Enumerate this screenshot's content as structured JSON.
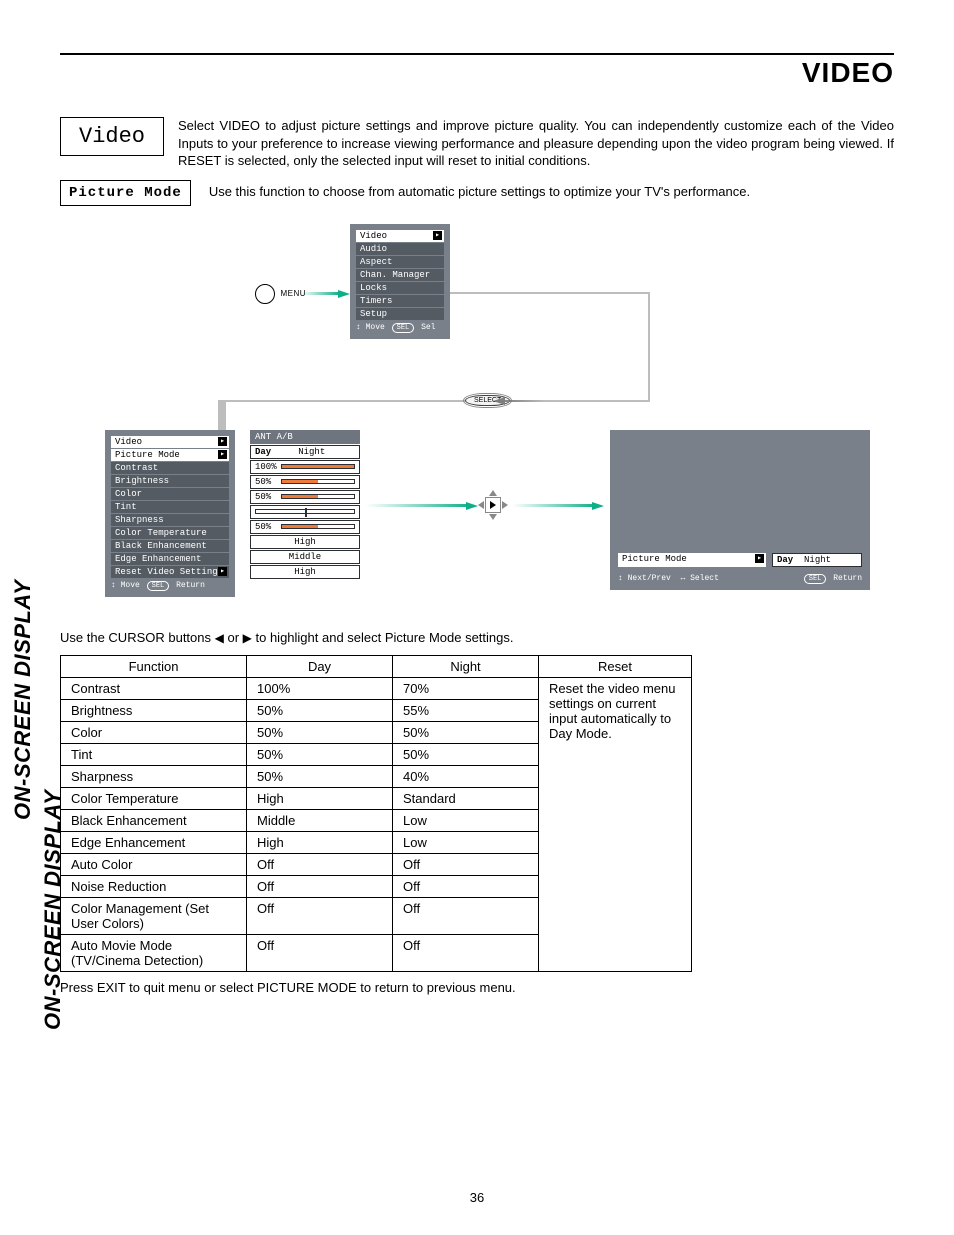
{
  "header": {
    "title": "VIDEO"
  },
  "intro": {
    "box_label": "Video",
    "text": "Select VIDEO to adjust picture settings and improve picture quality.  You can independently customize each of the Video Inputs to your preference to increase viewing performance and pleasure depending upon the video program being viewed.  If RESET is selected, only the selected input will reset to initial conditions."
  },
  "picture_mode": {
    "label": "Picture Mode",
    "text": "Use this function to choose from automatic picture settings to optimize your TV's performance."
  },
  "menu_button": {
    "label": "MENU"
  },
  "select_button": {
    "label": "SELECT"
  },
  "main_osd": {
    "items": [
      "Video",
      "Audio",
      "Aspect",
      "Chan. Manager",
      "Locks",
      "Timers",
      "Setup"
    ],
    "footer_move": "Move",
    "footer_sel": "Sel",
    "sel_pill": "SEL"
  },
  "video_osd": {
    "title": "Video",
    "items": [
      "Picture Mode",
      "Contrast",
      "Brightness",
      "Color",
      "Tint",
      "Sharpness",
      "Color Temperature",
      "Black Enhancement",
      "Edge Enhancement",
      "Reset Video Settings"
    ],
    "footer_move": "Move",
    "footer_return": "Return",
    "sel_pill": "SEL"
  },
  "video_vals": {
    "header": "ANT A/B",
    "rows": [
      {
        "label_left": "Day",
        "label_right": "Night",
        "type": "daynight"
      },
      {
        "label": "100%",
        "type": "bar",
        "fill": 100
      },
      {
        "label": "50%",
        "type": "bar",
        "fill": 50
      },
      {
        "label": "50%",
        "type": "bar",
        "fill": 50
      },
      {
        "type": "tint",
        "pos": 50
      },
      {
        "label": "50%",
        "type": "bar",
        "fill": 50
      },
      {
        "label": "High",
        "type": "text"
      },
      {
        "label": "Middle",
        "type": "text"
      },
      {
        "label": "High",
        "type": "text"
      }
    ]
  },
  "pm_osd": {
    "label": "Picture Mode",
    "day": "Day",
    "night": "Night",
    "footer_next": "Next/Prev",
    "footer_select": "Select",
    "footer_return": "Return",
    "sel_pill": "SEL"
  },
  "cursor_note_pre": "Use the CURSOR buttons ",
  "cursor_note_mid": " or ",
  "cursor_note_post": " to highlight and select Picture Mode settings.",
  "cursor_left": "◀",
  "cursor_right": "▶",
  "table": {
    "head": [
      "Function",
      "Day",
      "Night",
      "Reset"
    ],
    "reset_text": "Reset the video menu settings on current input automatically to Day Mode.",
    "rows": [
      [
        "Contrast",
        "100%",
        "70%"
      ],
      [
        "Brightness",
        "50%",
        "55%"
      ],
      [
        "Color",
        "50%",
        "50%"
      ],
      [
        "Tint",
        "50%",
        "50%"
      ],
      [
        "Sharpness",
        "50%",
        "40%"
      ],
      [
        "Color Temperature",
        "High",
        "Standard"
      ],
      [
        "Black Enhancement",
        "Middle",
        "Low"
      ],
      [
        "Edge Enhancement",
        "High",
        "Low"
      ],
      [
        "Auto Color",
        "Off",
        "Off"
      ],
      [
        "Noise Reduction",
        "Off",
        "Off"
      ],
      [
        "Color Management (Set User Colors)",
        "Off",
        "Off"
      ],
      [
        "Auto Movie Mode (TV/Cinema Detection)",
        "Off",
        "Off"
      ]
    ]
  },
  "exit_note": "Press EXIT to quit menu or select PICTURE MODE to return to previous menu.",
  "side_label": "ON-SCREEN DISPLAY",
  "page_number": "36",
  "arrows": {
    "updown": "↕",
    "leftright": "↔"
  }
}
